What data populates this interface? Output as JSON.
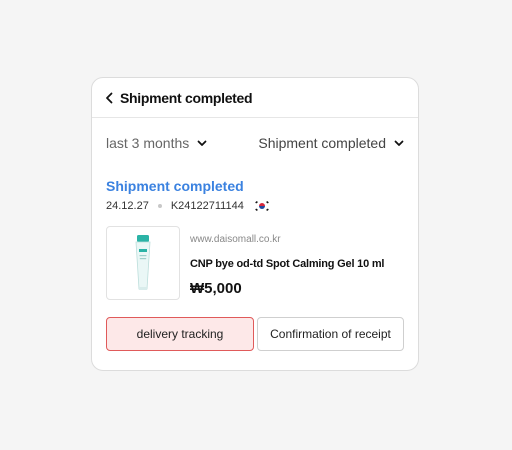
{
  "header": {
    "title": "Shipment completed",
    "back_icon": "chevron-left-icon"
  },
  "filters": {
    "period": "last 3 months",
    "status": "Shipment completed"
  },
  "order": {
    "status": "Shipment completed",
    "date": "24.12.27",
    "order_number": "K24122711144",
    "country_flag": "south-korea-flag-icon"
  },
  "product": {
    "shop": "www.daisomall.co.kr",
    "name": "CNP bye od-td Spot Calming Gel 10 ml",
    "price": "₩5,000"
  },
  "actions": {
    "track_label": "delivery tracking",
    "confirm_label": "Confirmation of receipt"
  },
  "colors": {
    "status_blue": "#3b82e0",
    "track_border": "#e05a5a",
    "track_fill": "#fde8e8"
  }
}
